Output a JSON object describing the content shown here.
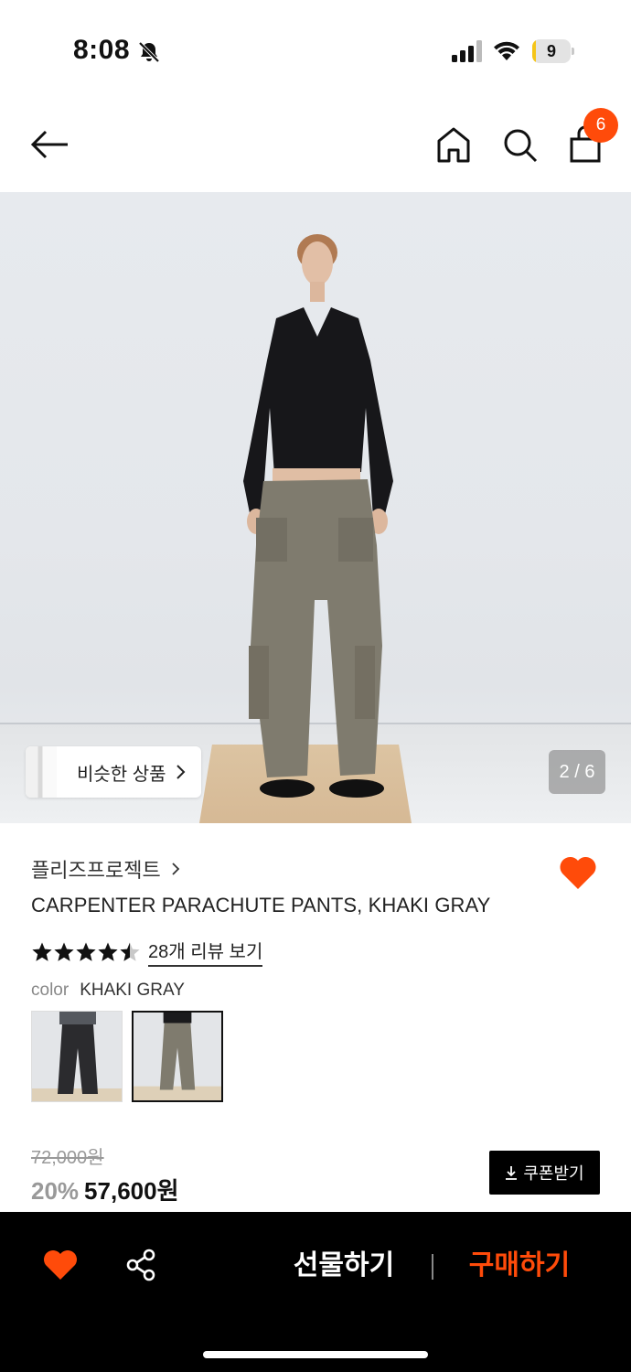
{
  "status_bar": {
    "time": "8:08",
    "battery_level": "9",
    "battery_fraction": 0.09
  },
  "header": {
    "cart_count": "6"
  },
  "gallery": {
    "similar_label": "비슷한 상품",
    "page_indicator": "2 / 6"
  },
  "product": {
    "brand": "플리즈프로젝트",
    "title": "CARPENTER PARACHUTE PANTS, KHAKI GRAY",
    "rating": 4.5,
    "rating_max": 5,
    "review_link": "28개 리뷰 보기",
    "color_key": "color",
    "color_value": "KHAKI GRAY",
    "swatches": [
      "charcoal",
      "khaki-gray"
    ],
    "selected_swatch_index": 1
  },
  "pricing": {
    "original_price": "72,000원",
    "discount": "20%",
    "final_price": "57,600원",
    "coupon_label": "쿠폰받기"
  },
  "bottom_bar": {
    "gift_label": "선물하기",
    "buy_label": "구매하기"
  },
  "colors": {
    "accent": "#ff4b0a",
    "bottom_bar_bg": "#000000",
    "heart": "#ff4b0a"
  },
  "icons": [
    "bell-slash-icon",
    "signal-icon",
    "wifi-icon",
    "battery-icon",
    "back-arrow-icon",
    "home-icon",
    "search-icon",
    "shopping-bag-icon",
    "heart-icon",
    "share-icon",
    "download-icon",
    "chevron-right-icon",
    "star-icon"
  ]
}
